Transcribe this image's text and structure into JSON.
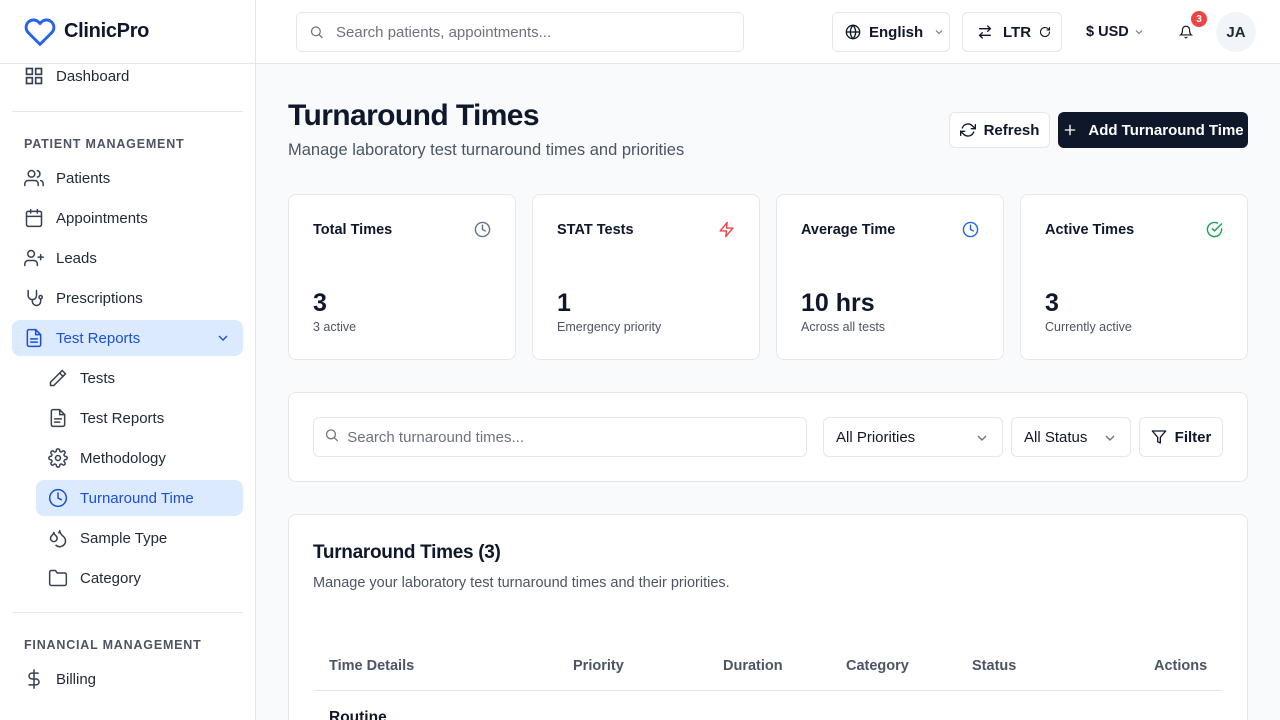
{
  "brand": {
    "name": "ClinicPro"
  },
  "sidebar": {
    "partial_item": "Dashboard",
    "sections": [
      {
        "label": "PATIENT MANAGEMENT"
      },
      {
        "label": "FINANCIAL MANAGEMENT"
      }
    ],
    "items": [
      {
        "label": "Patients",
        "icon": "users-icon"
      },
      {
        "label": "Appointments",
        "icon": "calendar-icon"
      },
      {
        "label": "Leads",
        "icon": "user-plus-icon"
      },
      {
        "label": "Prescriptions",
        "icon": "stethoscope-icon"
      },
      {
        "label": "Test Reports",
        "icon": "file-text-icon",
        "expanded": true
      },
      {
        "label": "Tests",
        "icon": "pencil-icon"
      },
      {
        "label": "Test Reports",
        "icon": "file-icon"
      },
      {
        "label": "Methodology",
        "icon": "gear-icon"
      },
      {
        "label": "Turnaround Time",
        "icon": "clock-icon",
        "active": true
      },
      {
        "label": "Sample Type",
        "icon": "droplets-icon"
      },
      {
        "label": "Category",
        "icon": "folder-icon"
      },
      {
        "label": "Billing",
        "icon": "dollar-icon"
      }
    ]
  },
  "topbar": {
    "search_placeholder": "Search patients, appointments...",
    "language": "English",
    "direction": "LTR",
    "currency": "$ USD",
    "notifications_count": "3",
    "user_initials": "JA"
  },
  "page": {
    "title": "Turnaround Times",
    "subtitle": "Manage laboratory test turnaround times and priorities",
    "refresh_label": "Refresh",
    "add_label": "Add Turnaround Time"
  },
  "stats": [
    {
      "title": "Total Times",
      "value": "3",
      "desc": "3 active",
      "icon": "clock-icon",
      "color": "#64748b"
    },
    {
      "title": "STAT Tests",
      "value": "1",
      "desc": "Emergency priority",
      "icon": "zap-icon",
      "color": "#ef4444"
    },
    {
      "title": "Average Time",
      "value": "10 hrs",
      "desc": "Across all tests",
      "icon": "clock-icon",
      "color": "#2563eb"
    },
    {
      "title": "Active Times",
      "value": "3",
      "desc": "Currently active",
      "icon": "check-circle-icon",
      "color": "#16a34a"
    }
  ],
  "filters": {
    "search_placeholder": "Search turnaround times...",
    "priority": "All Priorities",
    "status": "All Status",
    "filter_label": "Filter"
  },
  "table": {
    "title": "Turnaround Times (3)",
    "subtitle": "Manage your laboratory test turnaround times and their priorities.",
    "columns": [
      "Time Details",
      "Priority",
      "Duration",
      "Category",
      "Status",
      "Actions"
    ],
    "rows": [
      {
        "name": "Routine"
      }
    ]
  }
}
